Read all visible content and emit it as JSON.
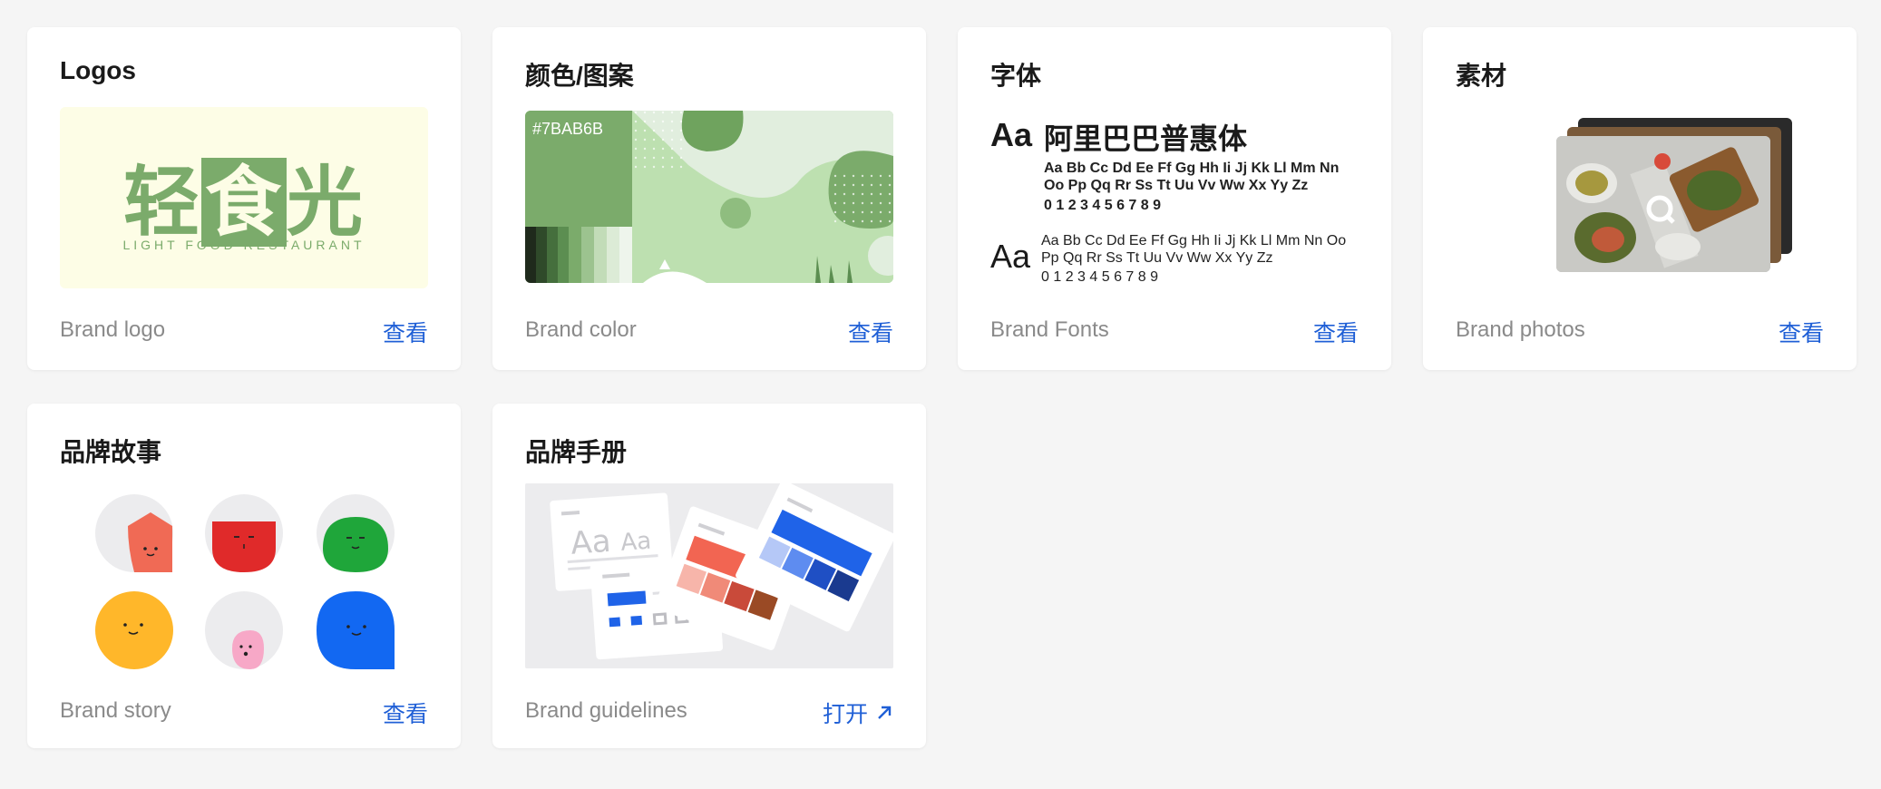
{
  "cards": [
    {
      "title": "Logos",
      "subtitle": "Brand logo",
      "action": "查看"
    },
    {
      "title": "颜色/图案",
      "subtitle": "Brand color",
      "action": "查看"
    },
    {
      "title": "字体",
      "subtitle": "Brand Fonts",
      "action": "查看"
    },
    {
      "title": "素材",
      "subtitle": "Brand photos",
      "action": "查看"
    },
    {
      "title": "品牌故事",
      "subtitle": "Brand story",
      "action": "查看"
    },
    {
      "title": "品牌手册",
      "subtitle": "Brand guidelines",
      "action": "打开"
    }
  ],
  "logo": {
    "left": "轻",
    "mid": "食",
    "right": "光",
    "sub": "LIGHT FOOD RESTAURANT",
    "color": "#7BAB6B",
    "bg": "#FDFDE6"
  },
  "color_preview": {
    "hex": "#7BAB6B"
  },
  "fonts": {
    "aa": "Aa",
    "bold_name": "阿里巴巴普惠体",
    "bold_line1": "Aa Bb Cc Dd Ee Ff Gg Hh Ii Jj Kk Ll Mm Nn",
    "bold_line2": "Oo Pp Qq Rr Ss Tt Uu Vv Ww Xx Yy Zz",
    "bold_digits": "0 1 2 3 4 5 6 7 8 9",
    "regular_line1": "Aa Bb Cc Dd Ee Ff Gg Hh Ii Jj Kk Ll Mm Nn Oo",
    "regular_line2": "Pp Qq Rr Ss Tt Uu Vv Ww Xx Yy Zz",
    "regular_digits": "0 1 2 3 4 5 6 7 8 9"
  },
  "colors": {
    "accent": "#1F5FD6",
    "page_bg": "#F5F5F5",
    "card_bg": "#FFFFFF"
  }
}
